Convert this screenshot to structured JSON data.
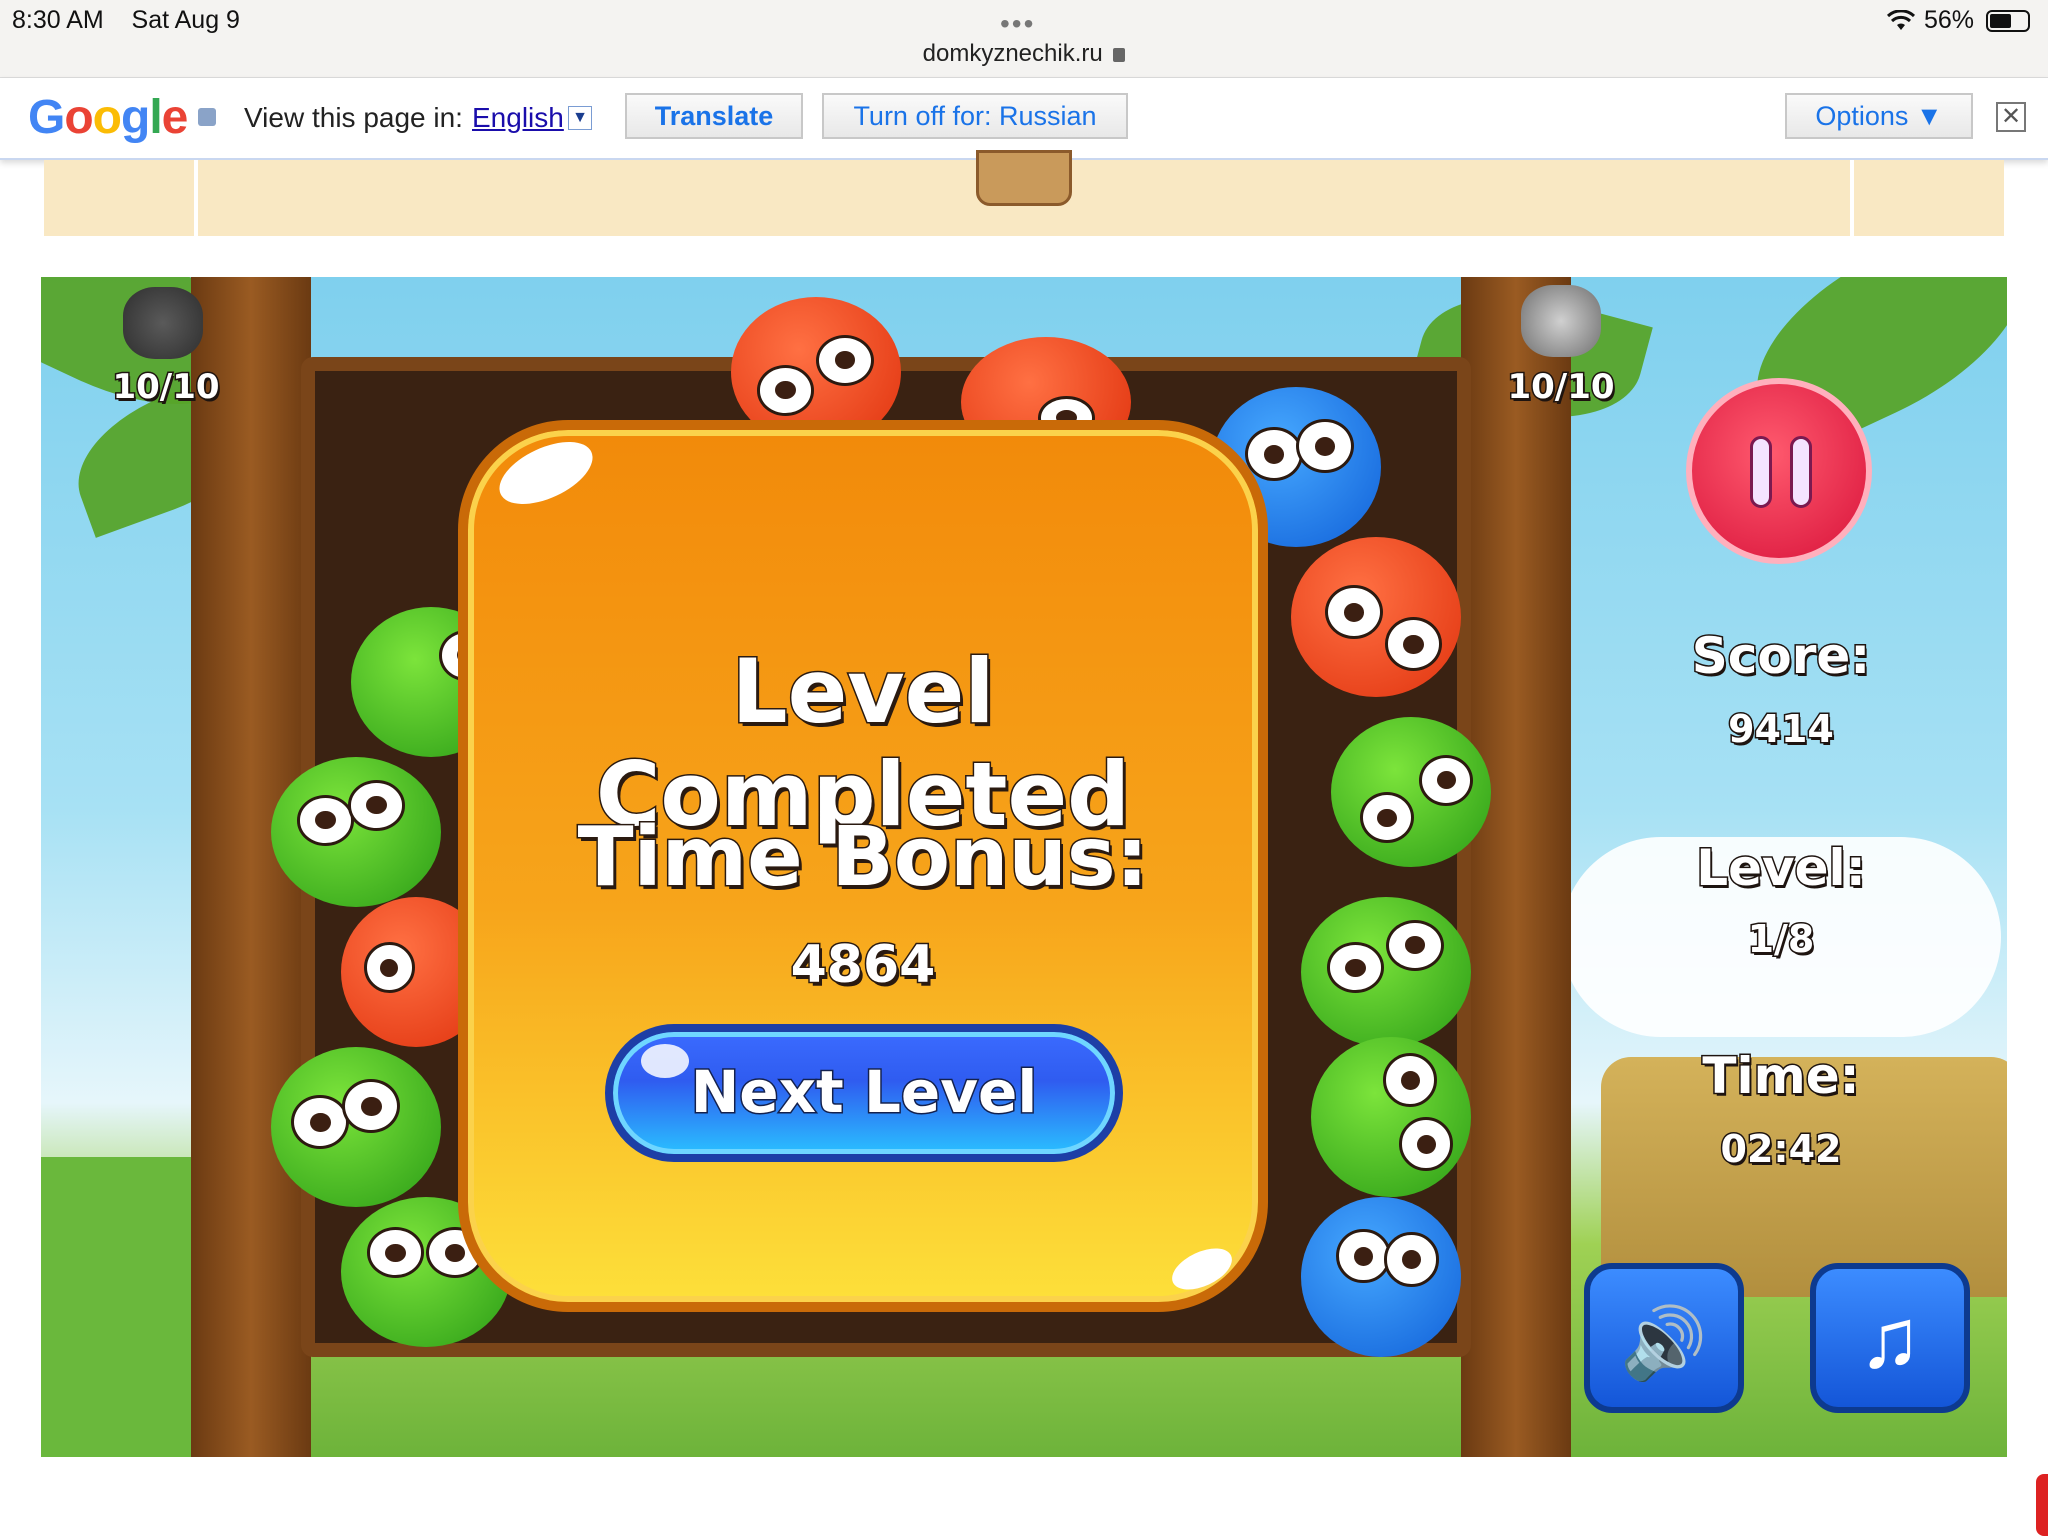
{
  "status_bar": {
    "time": "8:30 AM",
    "date": "Sat Aug 9",
    "url": "domkyznechik.ru",
    "battery": "56%"
  },
  "translate_bar": {
    "prompt": "View this page in:",
    "language": "English",
    "translate_label": "Translate",
    "turn_off_label": "Turn off for: Russian",
    "options_label": "Options ▼",
    "close_glyph": "✕"
  },
  "game": {
    "left_counter": "10/10",
    "right_counter": "10/10",
    "score_label": "Score:",
    "score_value": "9414",
    "level_label": "Level:",
    "level_value": "1/8",
    "time_label": "Time:",
    "time_value": "02:42"
  },
  "dialog": {
    "title": "Level Completed",
    "bonus_label": "Time Bonus:",
    "bonus_value": "4864",
    "next_label": "Next Level"
  },
  "icons": {
    "sound": "🔊",
    "music": "♫"
  }
}
